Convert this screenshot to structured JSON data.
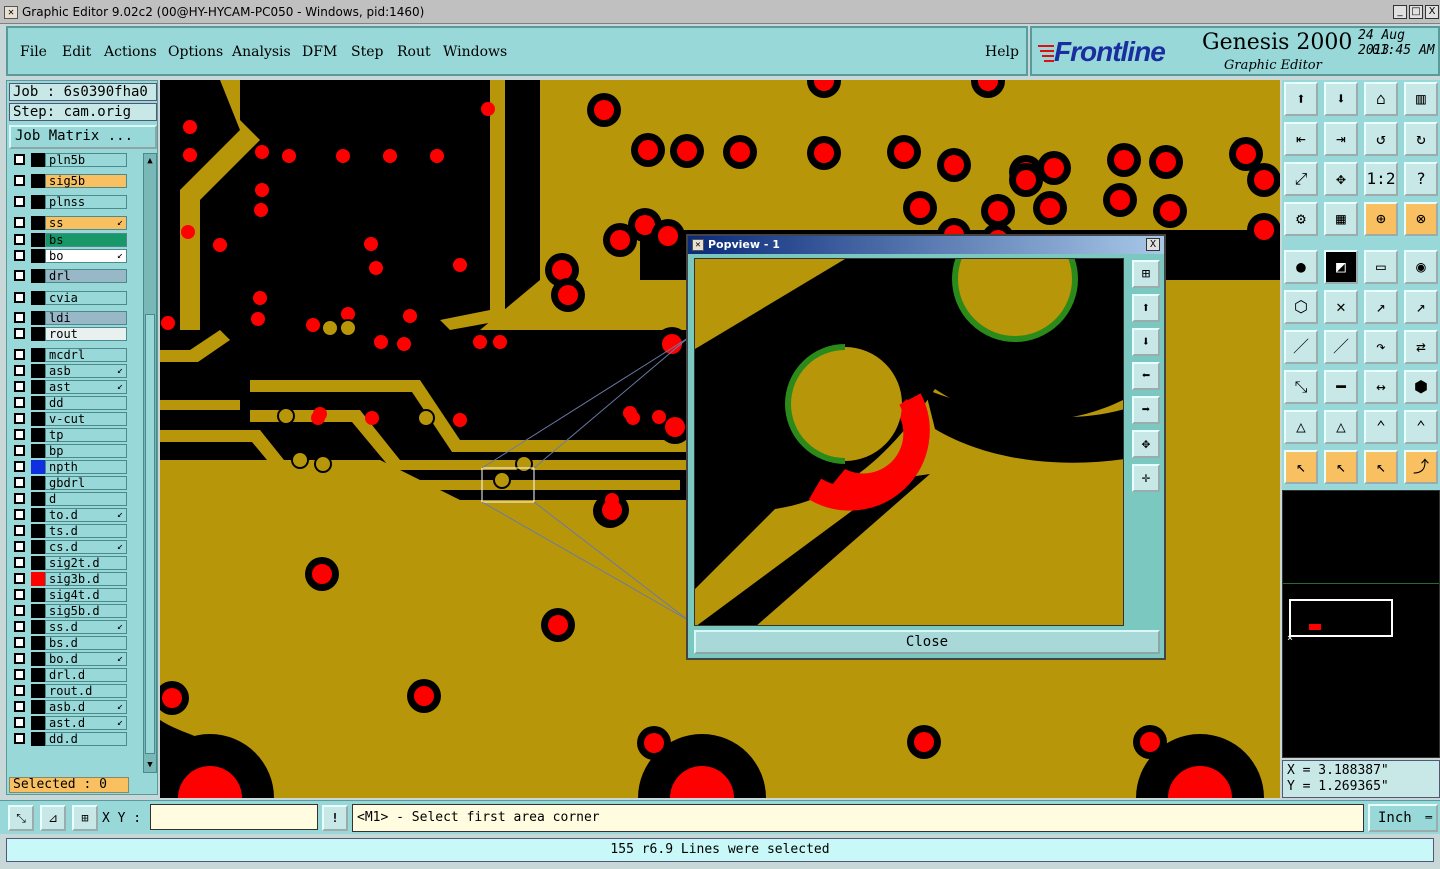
{
  "window": {
    "title": "Graphic Editor 9.02c2 (00@HY-HYCAM-PC050 - Windows, pid:1460)",
    "min": "_",
    "max": "□",
    "close": "X"
  },
  "menu": {
    "file": "File",
    "edit": "Edit",
    "actions": "Actions",
    "options": "Options",
    "analysis": "Analysis",
    "dfm": "DFM",
    "step": "Step",
    "rout": "Rout",
    "windows": "Windows",
    "help": "Help"
  },
  "brand": {
    "logo": "Frontline",
    "product": "Genesis 2000",
    "subtitle": "Graphic Editor",
    "date": "24 Aug 2013",
    "time": "01:45 AM"
  },
  "left_panel": {
    "job": "Job : 6s0390fha0",
    "step": "Step: cam.orig",
    "job_matrix": "Job Matrix ...",
    "selected": "Selected : 0",
    "layers": [
      {
        "name": "pln5b",
        "color": "#98d8d8",
        "swatch": "#000000",
        "mark": ""
      },
      {
        "name": "sig5b",
        "color": "#f8c060",
        "swatch": "#000000",
        "mark": ""
      },
      {
        "name": "plnss",
        "color": "#98d8d8",
        "swatch": "#000000",
        "mark": ""
      },
      {
        "name": "ss",
        "color": "#f8c060",
        "swatch": "#000000",
        "mark": "↙"
      },
      {
        "name": "bs",
        "color": "#189868",
        "swatch": "#000000",
        "mark": ""
      },
      {
        "name": "bo",
        "color": "#ffffff",
        "swatch": "#000000",
        "mark": "↙"
      },
      {
        "name": "drl",
        "color": "#98b8c8",
        "swatch": "#000000",
        "mark": ""
      },
      {
        "name": "cvia",
        "color": "#98d8d8",
        "swatch": "#000000",
        "mark": ""
      },
      {
        "name": "ldi",
        "color": "#98b8c8",
        "swatch": "#000000",
        "mark": ""
      },
      {
        "name": "rout",
        "color": "#e8f0f0",
        "swatch": "#000000",
        "mark": ""
      },
      {
        "name": "mcdrl",
        "color": "#98d8d8",
        "swatch": "#000000",
        "mark": ""
      },
      {
        "name": "asb",
        "color": "#98d8d8",
        "swatch": "#000000",
        "mark": "↙"
      },
      {
        "name": "ast",
        "color": "#98d8d8",
        "swatch": "#000000",
        "mark": "↙"
      },
      {
        "name": "dd",
        "color": "#98d8d8",
        "swatch": "#000000",
        "mark": ""
      },
      {
        "name": "v-cut",
        "color": "#98d8d8",
        "swatch": "#000000",
        "mark": ""
      },
      {
        "name": "tp",
        "color": "#98d8d8",
        "swatch": "#000000",
        "mark": ""
      },
      {
        "name": "bp",
        "color": "#98d8d8",
        "swatch": "#000000",
        "mark": ""
      },
      {
        "name": "npth",
        "color": "#98d8d8",
        "swatch": "#1030e0",
        "mark": ""
      },
      {
        "name": "gbdrl",
        "color": "#98d8d8",
        "swatch": "#000000",
        "mark": ""
      },
      {
        "name": "d",
        "color": "#98d8d8",
        "swatch": "#000000",
        "mark": ""
      },
      {
        "name": "to.d",
        "color": "#98d8d8",
        "swatch": "#000000",
        "mark": "↙"
      },
      {
        "name": "ts.d",
        "color": "#98d8d8",
        "swatch": "#000000",
        "mark": ""
      },
      {
        "name": "cs.d",
        "color": "#98d8d8",
        "swatch": "#000000",
        "mark": "↙"
      },
      {
        "name": "sig2t.d",
        "color": "#98d8d8",
        "swatch": "#000000",
        "mark": ""
      },
      {
        "name": "sig3b.d",
        "color": "#98d8d8",
        "swatch": "#ff0000",
        "mark": ""
      },
      {
        "name": "sig4t.d",
        "color": "#98d8d8",
        "swatch": "#000000",
        "mark": ""
      },
      {
        "name": "sig5b.d",
        "color": "#98d8d8",
        "swatch": "#000000",
        "mark": ""
      },
      {
        "name": "ss.d",
        "color": "#98d8d8",
        "swatch": "#000000",
        "mark": "↙"
      },
      {
        "name": "bs.d",
        "color": "#98d8d8",
        "swatch": "#000000",
        "mark": ""
      },
      {
        "name": "bo.d",
        "color": "#98d8d8",
        "swatch": "#000000",
        "mark": "↙"
      },
      {
        "name": "drl.d",
        "color": "#98d8d8",
        "swatch": "#000000",
        "mark": ""
      },
      {
        "name": "rout.d",
        "color": "#98d8d8",
        "swatch": "#000000",
        "mark": ""
      },
      {
        "name": "asb.d",
        "color": "#98d8d8",
        "swatch": "#000000",
        "mark": "↙"
      },
      {
        "name": "ast.d",
        "color": "#98d8d8",
        "swatch": "#000000",
        "mark": "↙"
      },
      {
        "name": "dd.d",
        "color": "#98d8d8",
        "swatch": "#000000",
        "mark": ""
      }
    ]
  },
  "popup": {
    "title": "Popview - 1",
    "close_x": "X",
    "close_button": "Close"
  },
  "coords": {
    "x": "X = 3.188387\"",
    "y": "Y = 1.269365\""
  },
  "command": {
    "xy_label": "X Y :",
    "xy_value": "",
    "prompt": "<M1> - Select first area corner",
    "unit": "Inch",
    "info_btn": "!"
  },
  "status": "155 r6.9 Lines were selected",
  "colors": {
    "copper": "#b8960a",
    "pad": "#ff0000",
    "panel": "#98d8d8"
  }
}
